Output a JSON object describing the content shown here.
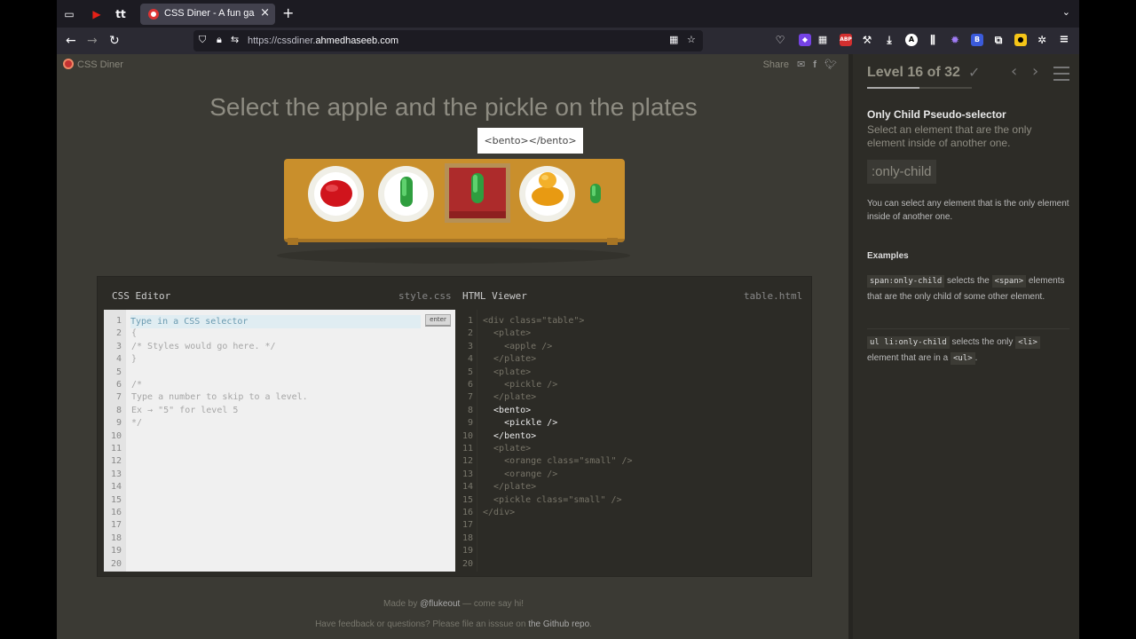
{
  "browser": {
    "tab_title": "CSS Diner - A fun game to help",
    "url_prefix": "https://cssdiner.",
    "url_domain": "ahmedhaseeb.com"
  },
  "game": {
    "logo_text": "CSS Diner",
    "share_label": "Share",
    "order_title": "Select the apple and the pickle on the plates",
    "tooltip": "<bento></bento>"
  },
  "editor": {
    "css_header": "CSS Editor",
    "css_file": "style.css",
    "html_header": "HTML Viewer",
    "html_file": "table.html",
    "placeholder": "Type in a CSS selector",
    "enter_label": "enter",
    "line_numbers": [
      "1",
      "2",
      "3",
      "4",
      "5",
      "6",
      "7",
      "8",
      "9",
      "10",
      "11",
      "12",
      "13",
      "14",
      "15",
      "16",
      "17",
      "18",
      "19",
      "20"
    ],
    "css_lines": [
      "{",
      "/* Styles would go here. */",
      "}",
      "",
      "/*",
      "Type a number to skip to a level.",
      "Ex → \"5\" for level 5",
      "*/"
    ],
    "html_lines": [
      "<div class=\"table\">",
      "  <plate>",
      "    <apple />",
      "  </plate>",
      "  <plate>",
      "    <pickle />",
      "  </plate>",
      "  <bento>",
      "    <pickle />",
      "  </bento>",
      "  <plate>",
      "    <orange class=\"small\" />",
      "    <orange />",
      "  </plate>",
      "  <pickle class=\"small\" />",
      "</div>"
    ],
    "highlighted_html_lines": [
      8,
      9,
      10
    ]
  },
  "footer": {
    "made_by_prefix": "Made by ",
    "made_by_handle": "@flukeout",
    "made_by_suffix": " — come say hi!",
    "feedback_prefix": "Have feedback or questions? Please file an isssue on ",
    "feedback_link": "the Github repo",
    "feedback_suffix": "."
  },
  "sidebar": {
    "level_label": "Level 16 of 32",
    "level_complete": true,
    "progress_fraction": 0.5,
    "selector_name": "Only Child Pseudo-selector",
    "title": "Select an element that are the only element inside of another one.",
    "syntax": ":only-child",
    "hint": "You can select any element that is the only element inside of another one.",
    "examples_header": "Examples",
    "example1_code1": "span:only-child",
    "example1_text1": " selects the ",
    "example1_code2": "<span>",
    "example1_text2": " elements that are the only child of some other element.",
    "example2_code1": "ul li:only-child",
    "example2_text1": " selects the only ",
    "example2_code2": "<li>",
    "example2_text2": " element that are in a ",
    "example2_code3": "<ul>",
    "example2_text3": "."
  },
  "colors": {
    "apple": "#d0141c",
    "pickle": "#39b54a",
    "orange": "#f0a01b",
    "table": "#c98f2c",
    "bento": "#ad2b2b"
  }
}
